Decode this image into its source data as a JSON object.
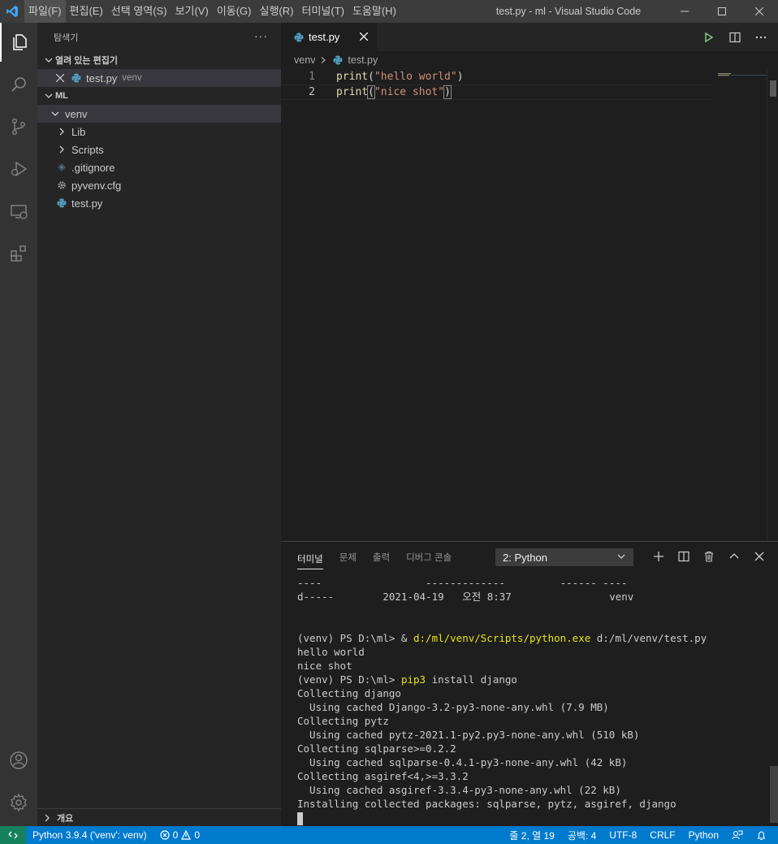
{
  "window": {
    "title": "test.py - ml - Visual Studio Code",
    "menu": [
      "파일(F)",
      "편집(E)",
      "선택 영역(S)",
      "보기(V)",
      "이동(G)",
      "실행(R)",
      "터미널(T)",
      "도움말(H)"
    ]
  },
  "sidebar": {
    "title": "탐색기",
    "more": "···",
    "open_editors": {
      "header": "열려 있는 편집기",
      "items": [
        {
          "name": "test.py",
          "desc": "venv"
        }
      ]
    },
    "workspace": {
      "header": "ML",
      "folder": "venv",
      "items": [
        {
          "name": "Lib",
          "kind": "folder"
        },
        {
          "name": "Scripts",
          "kind": "folder"
        },
        {
          "name": ".gitignore",
          "kind": "git-file"
        },
        {
          "name": "pyvenv.cfg",
          "kind": "config-file"
        },
        {
          "name": "test.py",
          "kind": "python-file"
        }
      ]
    },
    "outline_header": "개요"
  },
  "editor": {
    "tab": {
      "label": "test.py"
    },
    "breadcrumb": [
      "venv",
      "test.py"
    ],
    "lines": [
      {
        "number": "1",
        "fn": "print",
        "arg": "\"hello world\""
      },
      {
        "number": "2",
        "fn": "print",
        "arg": "\"nice shot\""
      }
    ]
  },
  "panel": {
    "tabs": [
      "터미널",
      "문제",
      "출력",
      "디버그 콘솔"
    ],
    "selected_terminal": "2: Python",
    "terminal_lines": [
      {
        "text": "----                 -------------         ------ ----"
      },
      {
        "text": "d-----        2021-04-19   오전 8:37                venv"
      },
      {
        "text": ""
      },
      {
        "text": ""
      },
      {
        "prefix": "(venv) PS D:\\ml> & ",
        "cmd": "d:/ml/venv/Scripts/python.exe",
        "suffix": " d:/ml/venv/test.py"
      },
      {
        "text": "hello world"
      },
      {
        "text": "nice shot"
      },
      {
        "prefix": "(venv) PS D:\\ml> ",
        "cmd": "pip3",
        "suffix": " install django"
      },
      {
        "text": "Collecting django"
      },
      {
        "text": "  Using cached Django-3.2-py3-none-any.whl (7.9 MB)"
      },
      {
        "text": "Collecting pytz"
      },
      {
        "text": "  Using cached pytz-2021.1-py2.py3-none-any.whl (510 kB)"
      },
      {
        "text": "Collecting sqlparse>=0.2.2"
      },
      {
        "text": "  Using cached sqlparse-0.4.1-py3-none-any.whl (42 kB)"
      },
      {
        "text": "Collecting asgiref<4,>=3.3.2"
      },
      {
        "text": "  Using cached asgiref-3.3.4-py3-none-any.whl (22 kB)"
      },
      {
        "text": "Installing collected packages: sqlparse, pytz, asgiref, django"
      }
    ]
  },
  "statusbar": {
    "interpreter": "Python 3.9.4  ('venv': venv)",
    "errors": "0",
    "warnings": "0",
    "position": "줄 2, 열 19",
    "indent": "공백: 4",
    "encoding": "UTF-8",
    "eol": "CRLF",
    "language": "Python"
  },
  "colors": {
    "statusbar": "#007acc",
    "remote": "#16825d",
    "function": "#dcdcaa",
    "string": "#ce9178",
    "terminal_command": "#e5e510"
  }
}
